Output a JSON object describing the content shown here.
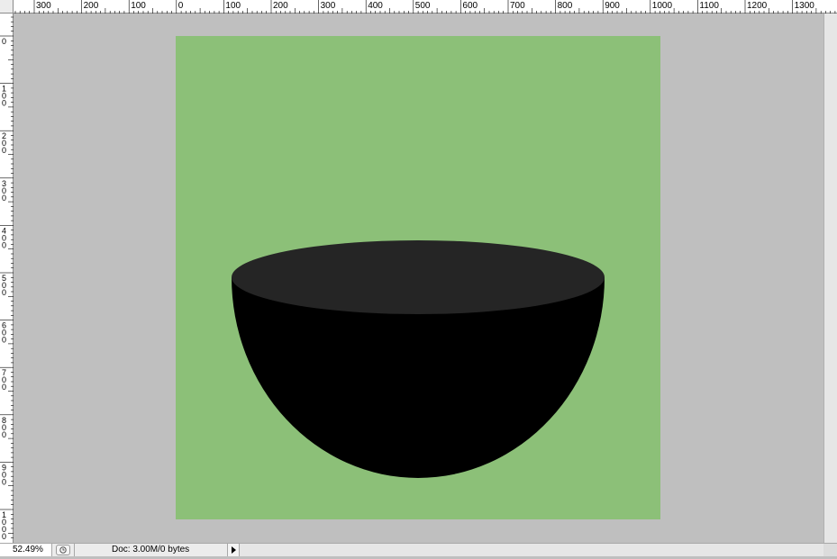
{
  "rulers": {
    "unit": "px",
    "horizontal_labels": [
      "300",
      "200",
      "100",
      "0",
      "100",
      "200",
      "300",
      "400",
      "500",
      "600",
      "700",
      "800",
      "900",
      "1000",
      "1100",
      "1200",
      "1300"
    ],
    "vertical_labels": [
      "0",
      "100",
      "200",
      "300",
      "400",
      "500",
      "600",
      "700",
      "800",
      "900",
      "1000"
    ]
  },
  "canvas": {
    "background_color": "#bfbfbf",
    "artboard_color": "#8cc078",
    "bowl_body_color": "#000000",
    "bowl_rim_color": "#252525"
  },
  "status_bar": {
    "zoom": "52.49%",
    "doc_info": "Doc: 3.00M/0 bytes"
  },
  "icons": [
    "status-menu-icon",
    "status-arrow-icon"
  ]
}
